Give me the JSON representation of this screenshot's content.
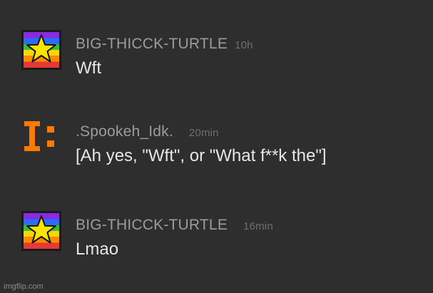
{
  "comments": [
    {
      "username": "BIG-THICCK-TURTLE",
      "time": "10h",
      "message": "Wft",
      "avatar_icon": "rainbow-star-icon"
    },
    {
      "username": ".Spookeh_Idk.",
      "time": "20min",
      "message": "[Ah yes, \"Wft\", or \"What f**k the\"]",
      "avatar_icon": "orange-glyph-icon"
    },
    {
      "username": "BIG-THICCK-TURTLE",
      "time": "16min",
      "message": "Lmao",
      "avatar_icon": "rainbow-star-icon"
    }
  ],
  "colors": {
    "background": "#2e2e2e",
    "username": "#9c9c9c",
    "timestamp": "#6f6f6f",
    "message": "#e6e6e6",
    "accent_orange": "#ff7a00",
    "star_yellow": "#f7e400"
  },
  "watermark": "imgflip.com"
}
